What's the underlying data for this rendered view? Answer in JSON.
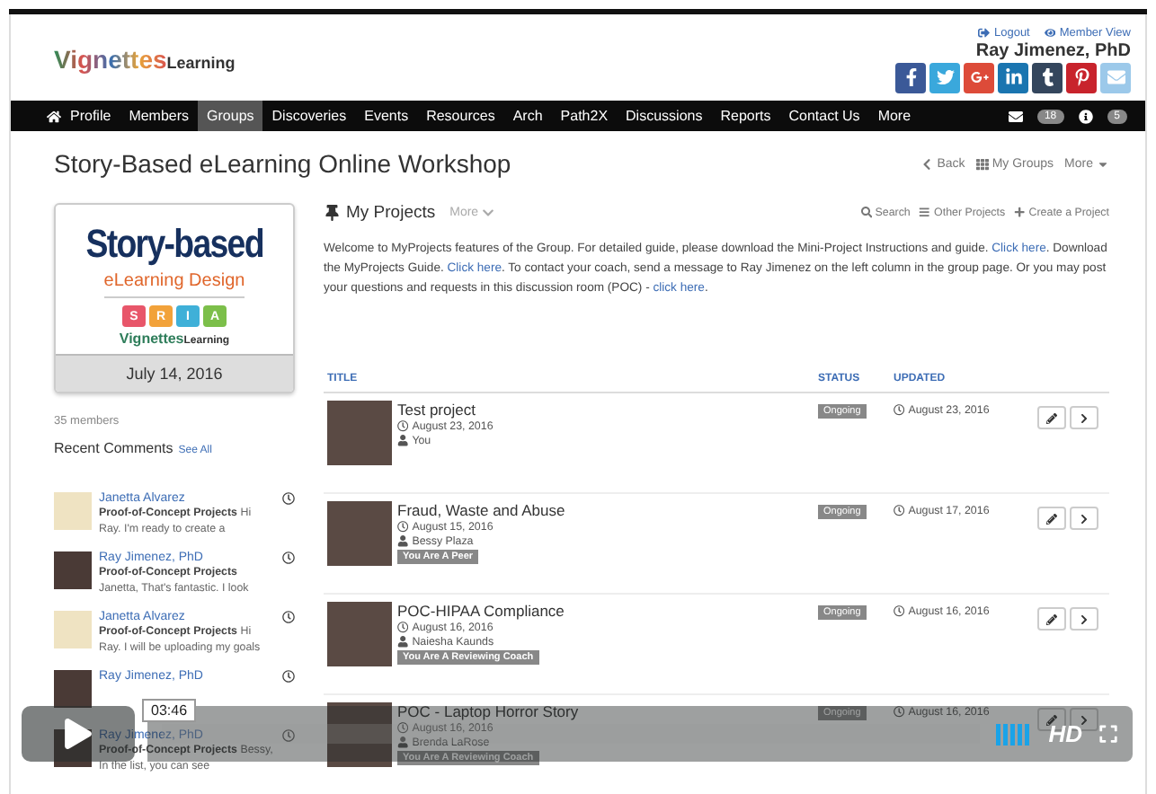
{
  "header": {
    "logo_main": "Vignettes",
    "logo_sub": "Learning",
    "links": [
      {
        "label": "Logout"
      },
      {
        "label": "Member View"
      }
    ],
    "user_name": "Ray Jimenez, PhD"
  },
  "nav": {
    "items": [
      {
        "label": "Profile",
        "selected": false
      },
      {
        "label": "Members",
        "selected": false
      },
      {
        "label": "Groups",
        "selected": true
      },
      {
        "label": "Discoveries",
        "selected": false
      },
      {
        "label": "Events",
        "selected": false
      },
      {
        "label": "Resources",
        "selected": false
      },
      {
        "label": "Arch",
        "selected": false
      },
      {
        "label": "Path2X",
        "selected": false
      },
      {
        "label": "Discussions",
        "selected": false
      },
      {
        "label": "Reports",
        "selected": false
      },
      {
        "label": "Contact Us",
        "selected": false
      },
      {
        "label": "More",
        "selected": false
      }
    ],
    "messages_count": "18",
    "alerts_count": "5"
  },
  "page": {
    "title": "Story-Based eLearning Online Workshop",
    "actions": [
      {
        "label": "Back",
        "kind": "back"
      },
      {
        "label": "My Groups",
        "kind": "groups"
      },
      {
        "label": "More",
        "kind": "dropdown"
      }
    ]
  },
  "group_card": {
    "headline": "Story-based",
    "subhead": "eLearning Design",
    "tiles": [
      {
        "letter": "S",
        "color": "#e8566a"
      },
      {
        "letter": "R",
        "color": "#f2a23a"
      },
      {
        "letter": "I",
        "color": "#3fb0d8"
      },
      {
        "letter": "A",
        "color": "#7cbf4a"
      }
    ],
    "brand_main": "Vignettes",
    "brand_sub": "Learning",
    "date": "July 14, 2016"
  },
  "members": "35 members",
  "recent_comments": {
    "title": "Recent Comments",
    "see_all": "See All",
    "items": [
      {
        "author": "Janetta Alvarez",
        "kind": "cartoon",
        "text": "**Proof-of-Concept Projects** Hi Ray. I'm ready to create a"
      },
      {
        "author": "Ray Jimenez, PhD",
        "kind": "photo",
        "text": "**Proof-of-Concept Projects** Janetta, That's fantastic. I look"
      },
      {
        "author": "Janetta Alvarez",
        "kind": "cartoon",
        "text": "**Proof-of-Concept Projects** Hi Ray. I will be uploading my goals"
      },
      {
        "author": "Ray Jimenez, PhD",
        "kind": "photo"
      },
      {
        "author": "Ray Jimenez, PhD",
        "kind": "photo",
        "text": "**Proof-of-Concept Projects** Bessy, In the list, you can see"
      }
    ]
  },
  "projects": {
    "title": "My Projects",
    "more": "More",
    "actions": [
      {
        "label": "Search",
        "kind": "search"
      },
      {
        "label": "Other Projects",
        "kind": "list"
      },
      {
        "label": "Create a Project",
        "kind": "plus"
      }
    ],
    "intro": [
      {
        "text": "Welcome to MyProjects features of the Group.  For detailed guide, please download the Mini-Project Instructions and guide. ",
        "link": false
      },
      {
        "text": "Click here",
        "link": true
      },
      {
        "text": ". Download the MyProjects Guide. ",
        "link": false
      },
      {
        "text": "Click here",
        "link": true
      },
      {
        "text": ". To contact your coach, send a message to Ray Jimenez on the left column in the group page. Or you may post your questions and requests in this discussion room (POC) - ",
        "link": false
      },
      {
        "text": "click here",
        "link": true
      },
      {
        "text": ".",
        "link": false
      }
    ],
    "columns": [
      "TITLE",
      "STATUS",
      "UPDATED"
    ],
    "rows": [
      {
        "title": "Test project",
        "created": "August 23, 2016",
        "owner": "You",
        "status": "Ongoing",
        "updated": "August 23, 2016"
      },
      {
        "title": "Fraud, Waste and Abuse",
        "created": "August 15, 2016",
        "owner": "Bessy Plaza",
        "role": "You Are A Peer",
        "status": "Ongoing",
        "updated": "August 17, 2016"
      },
      {
        "title": "POC-HIPAA Compliance",
        "created": "August 16, 2016",
        "owner": "Naiesha Kaunds",
        "role": "You Are A Reviewing Coach",
        "status": "Ongoing",
        "updated": "August 16, 2016"
      },
      {
        "title": "POC - Laptop Horror Story",
        "created": "August 16, 2016",
        "owner": "Brenda LaRose",
        "role": "You Are A Reviewing Coach",
        "status": "Ongoing",
        "updated": "August 16, 2016"
      }
    ]
  },
  "player": {
    "time": "03:46",
    "quality": "HD"
  }
}
